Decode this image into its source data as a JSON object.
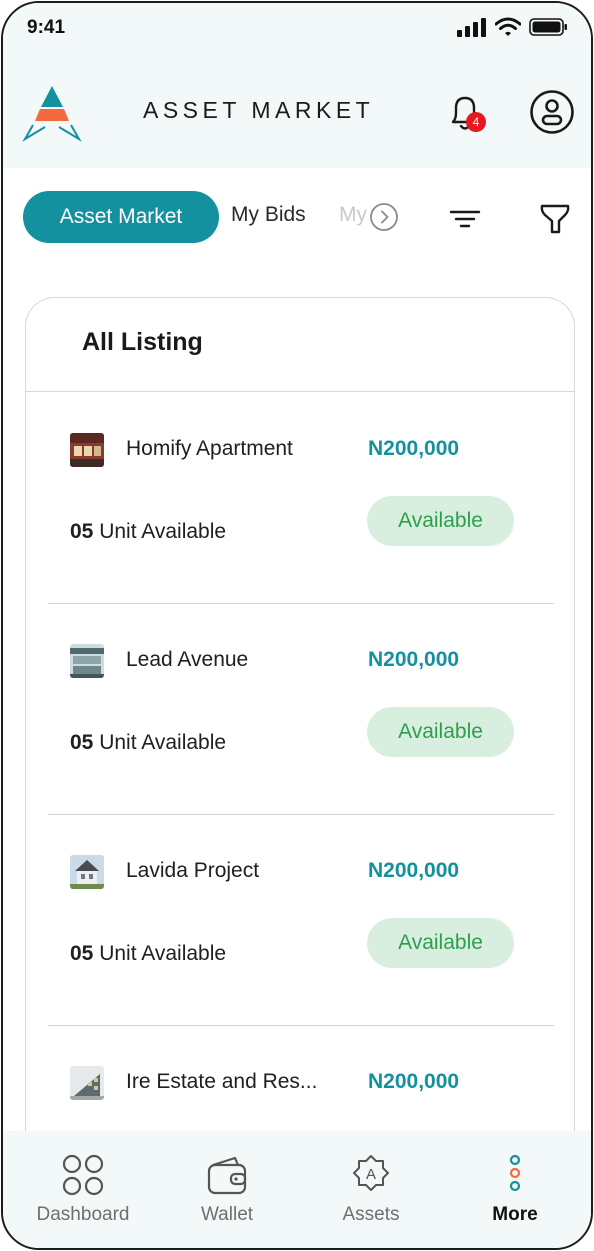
{
  "status_bar": {
    "time": "9:41"
  },
  "header": {
    "title": "ASSET MARKET",
    "notification_count": "4",
    "colors": {
      "brand": "#13919e",
      "accent": "#f26a3d"
    }
  },
  "tabs": {
    "active": "Asset Market",
    "second": "My Bids",
    "third_partial": "My"
  },
  "listing": {
    "title": "All Listing",
    "items": [
      {
        "name": "Homify Apartment",
        "price": "N200,000",
        "unit_count": "05",
        "unit_text": "Unit Available",
        "status": "Available",
        "thumb_icon": "apartment-photo"
      },
      {
        "name": "Lead Avenue",
        "price": "N200,000",
        "unit_count": "05",
        "unit_text": "Unit Available",
        "status": "Available",
        "thumb_icon": "building-photo"
      },
      {
        "name": "Lavida Project",
        "price": "N200,000",
        "unit_count": "05",
        "unit_text": "Unit Available",
        "status": "Available",
        "thumb_icon": "house-photo"
      },
      {
        "name": "Ire Estate and Res...",
        "price": "N200,000",
        "thumb_icon": "estate-photo"
      }
    ]
  },
  "bottom_nav": {
    "items": [
      {
        "label": "Dashboard",
        "icon": "dashboard-grid-icon"
      },
      {
        "label": "Wallet",
        "icon": "wallet-icon"
      },
      {
        "label": "Assets",
        "icon": "assets-badge-icon"
      },
      {
        "label": "More",
        "icon": "more-dots-icon",
        "active": true
      }
    ]
  }
}
